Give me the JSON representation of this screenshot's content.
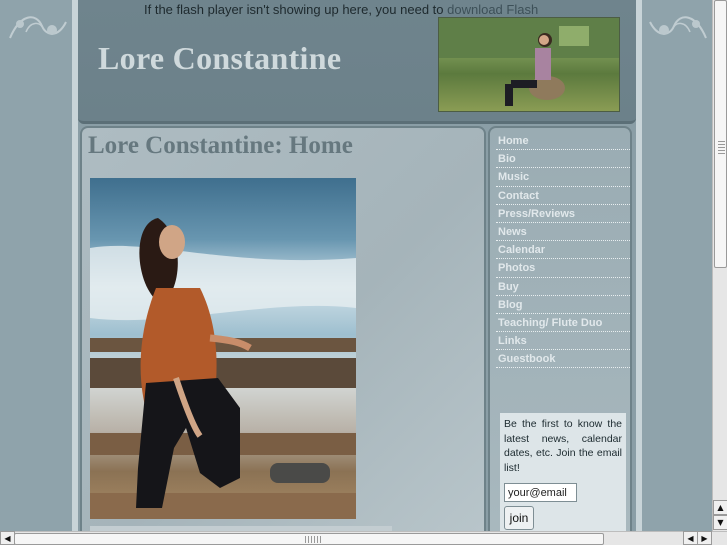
{
  "header": {
    "flash_notice": "If the flash player isn't showing up here, you need to ",
    "flash_link": "download Flash",
    "site_title": "Lore Constantine"
  },
  "content": {
    "page_title": "Lore Constantine: Home"
  },
  "sidebar": {
    "nav": [
      "Home",
      "Bio",
      "Music",
      "Contact",
      "Press/Reviews",
      "News",
      "Calendar",
      "Photos",
      "Buy",
      "Blog",
      "Teaching/ Flute Duo",
      "Links",
      "Guestbook"
    ],
    "signup": {
      "text": "Be the first to know the latest news, calendar dates, etc. Join the email list!",
      "email_value": "your@email",
      "join_label": "join"
    }
  },
  "scrollbars": {
    "up": "▲",
    "down": "▼",
    "left": "◀",
    "right": "▶"
  },
  "colors": {
    "header_bg": "#6f848d",
    "title_color": "#cfd9dc",
    "content_title": "#66787f",
    "nav_text": "#e1e8eb"
  }
}
